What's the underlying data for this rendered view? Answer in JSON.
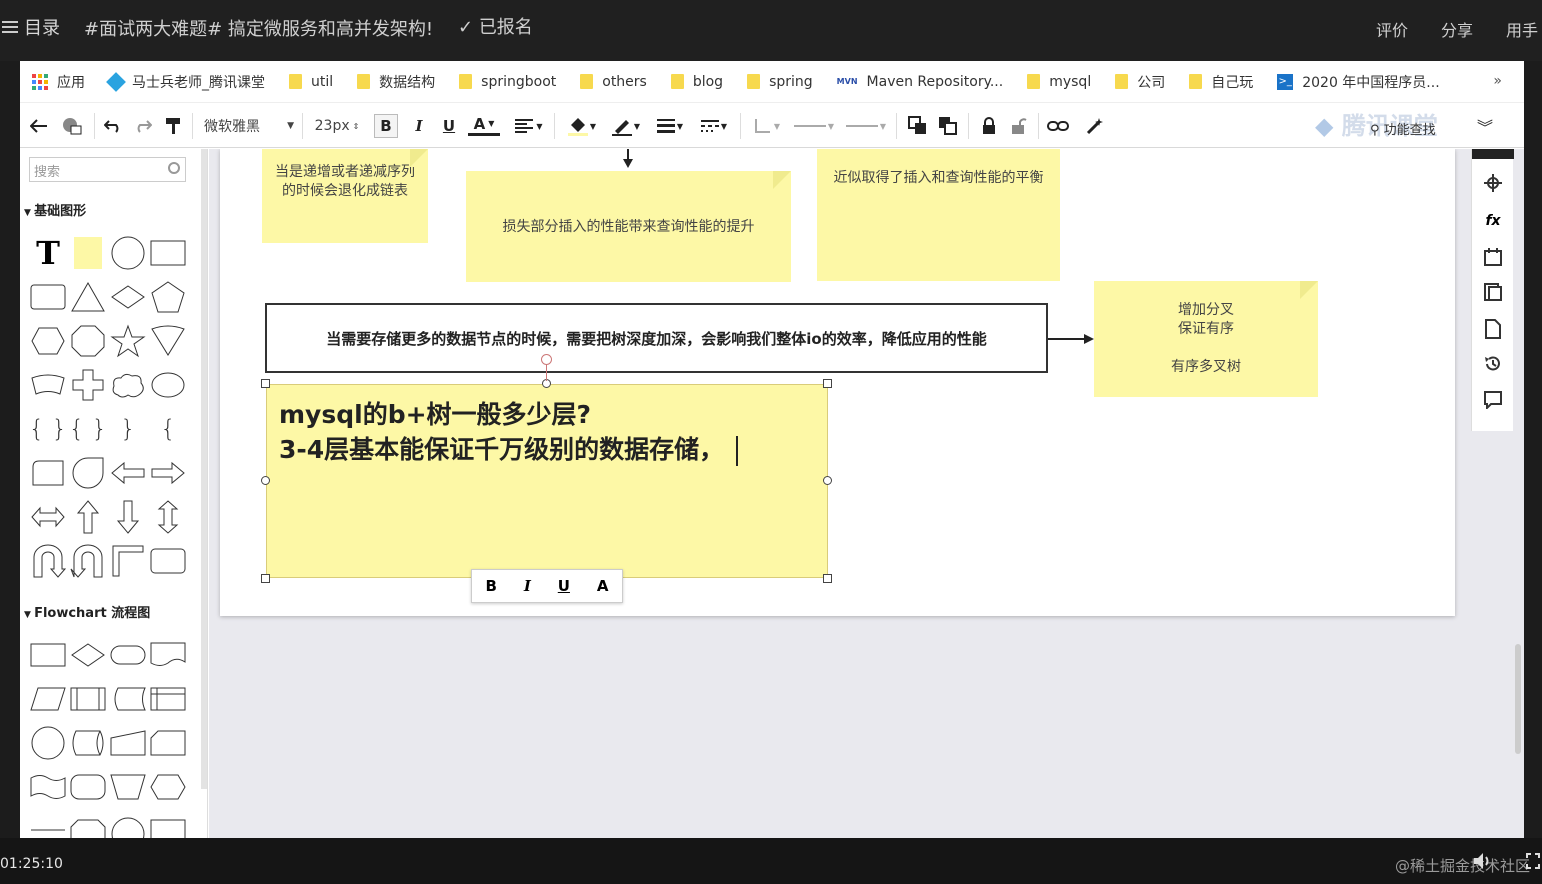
{
  "topbar": {
    "menu_icon": "hamburger-icon",
    "menu_label": "目录",
    "title": "#面试两大难题# 搞定微服务和高并发架构!",
    "enrolled_label": "已报名",
    "rate_label": "评价",
    "share_label": "分享",
    "mobile_label": "用手"
  },
  "bookmarks": {
    "items": [
      {
        "label": "应用",
        "icon": "apps-icon"
      },
      {
        "label": "马士兵老师_腾讯课堂",
        "icon": "site-icon"
      },
      {
        "label": "util",
        "icon": "folder-icon"
      },
      {
        "label": "数据结构",
        "icon": "folder-icon"
      },
      {
        "label": "springboot",
        "icon": "folder-icon"
      },
      {
        "label": "others",
        "icon": "folder-icon"
      },
      {
        "label": "blog",
        "icon": "folder-icon"
      },
      {
        "label": "spring",
        "icon": "folder-icon"
      },
      {
        "label": "Maven Repository...",
        "icon": "maven-icon",
        "icon_text": "MVN"
      },
      {
        "label": "mysql",
        "icon": "folder-icon"
      },
      {
        "label": "公司",
        "icon": "folder-icon"
      },
      {
        "label": "自己玩",
        "icon": "folder-icon"
      },
      {
        "label": "2020 年中国程序员...",
        "icon": "terminal-icon",
        "icon_text": ">_"
      }
    ],
    "more": "»"
  },
  "toolbar": {
    "font_family": "微软雅黑",
    "font_size": "23px",
    "bold": "B",
    "italic": "I",
    "underline": "U",
    "font_color": "A",
    "watermark": "腾讯课堂",
    "function_find": "功能查找"
  },
  "sidebar": {
    "search_placeholder": "搜索",
    "basic_section": "基础图形",
    "flowchart_section": "Flowchart 流程图"
  },
  "canvas": {
    "note1": "当是递增或者递减序列的时候会退化成链表",
    "note2": "损失部分插入的性能带来查询性能的提升",
    "note3": "近似取得了插入和查询性能的平衡",
    "box_text": "当需要存储更多的数据节点的时候，需要把树深度加深，会影响我们整体io的效率，降低应用的性能",
    "note4_line1": "增加分叉",
    "note4_line2": "保证有序",
    "note4_line3": "有序多叉树",
    "selected_line1": "mysql的b+树一般多少层?",
    "selected_line2": "3-4层基本能保证千万级别的数据存储，",
    "mini_toolbar": {
      "bold": "B",
      "italic": "I",
      "underline": "U",
      "color": "A"
    }
  },
  "player": {
    "time": "01:25:10",
    "credit": "@稀土掘金技术社区"
  },
  "colors": {
    "note_yellow": "#fdf8a6",
    "video_bar": "#202020"
  }
}
